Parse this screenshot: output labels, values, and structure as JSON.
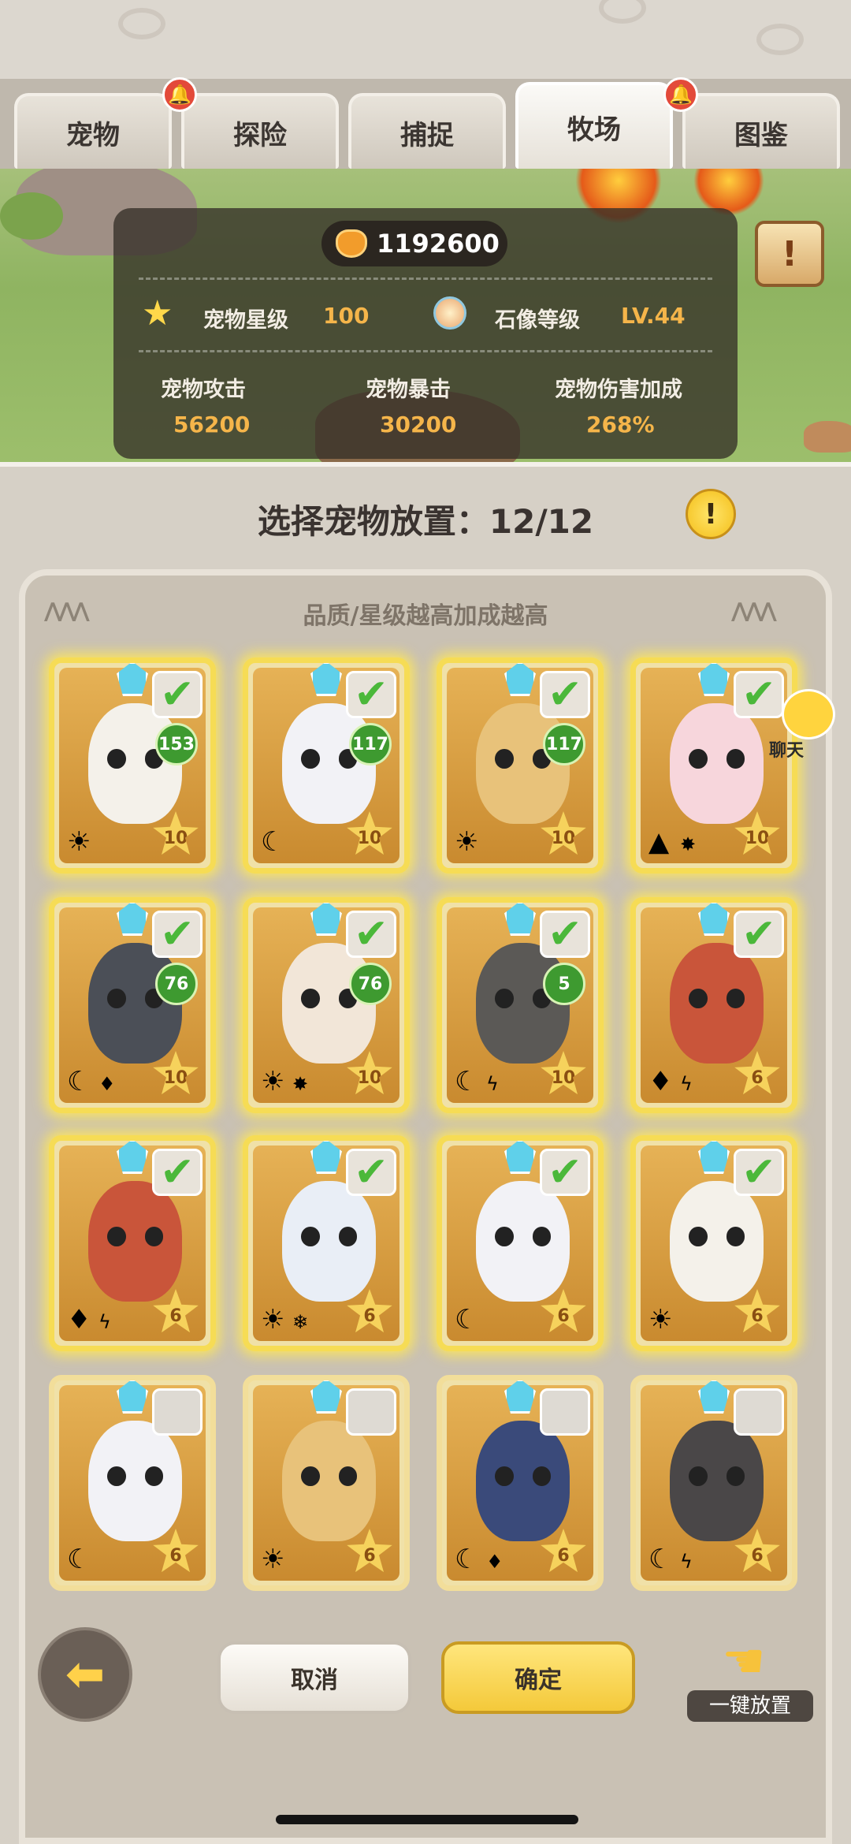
{
  "tabs": [
    {
      "label": "宠物",
      "notify": true
    },
    {
      "label": "探险",
      "notify": false
    },
    {
      "label": "捕捉",
      "notify": false
    },
    {
      "label": "牧场",
      "notify": true,
      "active": true
    },
    {
      "label": "图鉴",
      "notify": false
    }
  ],
  "stats": {
    "gold": "1192600",
    "pet_star_label": "宠物星级",
    "pet_star_value": "100",
    "statue_level_label": "石像等级",
    "statue_level_value": "LV.44",
    "attack_label": "宠物攻击",
    "attack_value": "56200",
    "crit_label": "宠物暴击",
    "crit_value": "30200",
    "damage_bonus_label": "宠物伤害加成",
    "damage_bonus_value": "268%"
  },
  "selection": {
    "title": "选择宠物放置：12/12",
    "hint": "品质/星级越高加成越高"
  },
  "chat": {
    "label": "聊天"
  },
  "pets": [
    {
      "level": "153",
      "stars": "10",
      "selected": true,
      "color": "#f4f1ea",
      "attr": "☀",
      "attr2": ""
    },
    {
      "level": "117",
      "stars": "10",
      "selected": true,
      "color": "#f2f2f6",
      "attr": "☾",
      "attr2": ""
    },
    {
      "level": "117",
      "stars": "10",
      "selected": true,
      "color": "#e8c27a",
      "attr": "☀",
      "attr2": ""
    },
    {
      "level": "",
      "stars": "10",
      "selected": true,
      "color": "#f7d6dc",
      "attr": "▲",
      "attr2": "✸"
    },
    {
      "level": "76",
      "stars": "10",
      "selected": true,
      "color": "#4b4f57",
      "attr": "☾",
      "attr2": "♦"
    },
    {
      "level": "76",
      "stars": "10",
      "selected": true,
      "color": "#f2e6d8",
      "attr": "☀",
      "attr2": "✸"
    },
    {
      "level": "5",
      "stars": "10",
      "selected": true,
      "color": "#5b5956",
      "attr": "☾",
      "attr2": "ϟ"
    },
    {
      "level": "",
      "stars": "6",
      "selected": true,
      "color": "#c9553a",
      "attr": "♦",
      "attr2": "ϟ"
    },
    {
      "level": "",
      "stars": "6",
      "selected": true,
      "color": "#c9553a",
      "attr": "♦",
      "attr2": "ϟ"
    },
    {
      "level": "",
      "stars": "6",
      "selected": true,
      "color": "#e9eef6",
      "attr": "☀",
      "attr2": "❄"
    },
    {
      "level": "",
      "stars": "6",
      "selected": true,
      "color": "#f2f2f6",
      "attr": "☾",
      "attr2": ""
    },
    {
      "level": "",
      "stars": "6",
      "selected": true,
      "color": "#f4f1ea",
      "attr": "☀",
      "attr2": ""
    },
    {
      "level": "",
      "stars": "6",
      "selected": false,
      "color": "#f2f2f6",
      "attr": "☾",
      "attr2": ""
    },
    {
      "level": "",
      "stars": "6",
      "selected": false,
      "color": "#e8c27a",
      "attr": "☀",
      "attr2": ""
    },
    {
      "level": "",
      "stars": "6",
      "selected": false,
      "color": "#3a4a7a",
      "attr": "☾",
      "attr2": "♦"
    },
    {
      "level": "",
      "stars": "6",
      "selected": false,
      "color": "#4a4748",
      "attr": "☾",
      "attr2": "ϟ"
    }
  ],
  "buttons": {
    "cancel": "取消",
    "confirm": "确定",
    "one_key": "一键放置"
  },
  "colors": {
    "accent_gold": "#f5b54a",
    "confirm_yellow": "#f4c93a",
    "selected_green": "#4bb83a"
  }
}
